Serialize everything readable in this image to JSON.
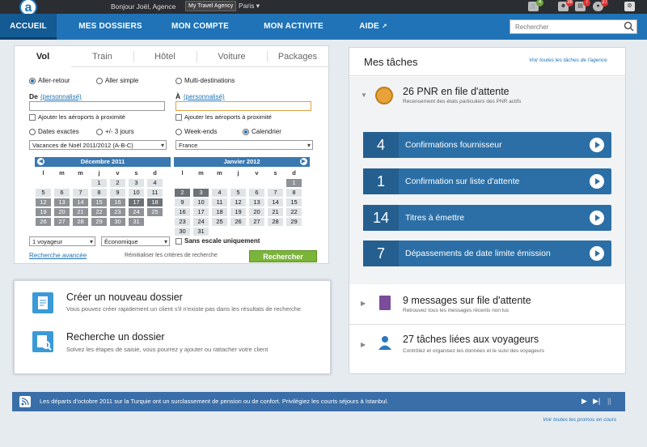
{
  "topbar": {
    "greeting": "Bonjour Joël, Agence",
    "agency": "My Travel Agency",
    "city": "Paris",
    "badges": [
      "4",
      "38",
      "7",
      "27"
    ]
  },
  "nav": {
    "items": [
      "ACCUEIL",
      "MES DOSSIERS",
      "MON COMPTE",
      "MON ACTIVITE",
      "AIDE"
    ],
    "search_placeholder": "Rechercher"
  },
  "booking": {
    "tabs": [
      "Vol",
      "Train",
      "Hôtel",
      "Voiture",
      "Packages"
    ],
    "trip_types": [
      "Aller-retour",
      "Aller simple",
      "Multi-destinations"
    ],
    "from_label": "De",
    "to_label": "À",
    "customize": "(personnalisé)",
    "nearby": "Ajouter les aéroports à proximité",
    "date_modes": [
      "Dates exactes",
      "+/- 3 jours",
      "Week-ends",
      "Calendrier"
    ],
    "period": "Vacances de Noël 2011/2012 (A-B-C)",
    "country": "France",
    "months": [
      {
        "title": "Décembre 2011",
        "weeks": [
          [
            "",
            "",
            "",
            "1",
            "2",
            "3",
            "4"
          ],
          [
            "5",
            "6",
            "7",
            "8",
            "9",
            "10",
            "11"
          ],
          [
            "12",
            "13",
            "14",
            "15",
            "16",
            "17",
            "18"
          ],
          [
            "19",
            "20",
            "21",
            "22",
            "23",
            "24",
            "25"
          ],
          [
            "26",
            "27",
            "28",
            "29",
            "30",
            "31",
            ""
          ]
        ]
      },
      {
        "title": "Janvier 2012",
        "weeks": [
          [
            "",
            "",
            "",
            "",
            "",
            "",
            "1"
          ],
          [
            "2",
            "3",
            "4",
            "5",
            "6",
            "7",
            "8"
          ],
          [
            "9",
            "10",
            "11",
            "12",
            "13",
            "14",
            "15"
          ],
          [
            "16",
            "17",
            "18",
            "19",
            "20",
            "21",
            "22"
          ],
          [
            "23",
            "24",
            "25",
            "26",
            "27",
            "28",
            "29"
          ],
          [
            "30",
            "31",
            "",
            "",
            "",
            "",
            ""
          ]
        ]
      }
    ],
    "weekdays": [
      "l",
      "m",
      "m",
      "j",
      "v",
      "s",
      "d"
    ],
    "travelers": "1 voyageur",
    "cabin": "Économique",
    "nonstop": "Sans escale uniquement",
    "advanced": "Recherche avancée",
    "reset": "Réinitialiser les critères de recherche",
    "search_btn": "Rechercher"
  },
  "dossiers": {
    "create_title": "Créer un nouveau dossier",
    "create_sub": "Vous pouvez créer rapidement un client s'il n'existe pas dans les résultats de recherche",
    "find_title": "Recherche un dossier",
    "find_sub": "Solvez les étapes de saisie, vous pourrez y ajouter ou rattacher votre client"
  },
  "tasks": {
    "title": "Mes tâches",
    "all_link": "Voir toutes les tâches de l'agence",
    "pnr_title": "26 PNR en file d'attente",
    "pnr_sub": "Recensement des états particuliers des PNR actifs",
    "rows": [
      {
        "count": "4",
        "label": "Confirmations fournisseur"
      },
      {
        "count": "1",
        "label": "Confirmation sur liste d'attente"
      },
      {
        "count": "14",
        "label": "Titres à émettre"
      },
      {
        "count": "7",
        "label": "Dépassements de date limite émission"
      }
    ],
    "msg_title": "9 messages sur file d'attente",
    "msg_sub": "Retrouvez tous les messages récents non lus",
    "trav_title": "27 tâches liées aux voyageurs",
    "trav_sub": "Contrôlez et organisez les données et le suivi des voyageurs"
  },
  "ticker": {
    "text": "Les départs d'octobre 2011 sur la Turquie ont un surclassement de pension ou de confort. Privilégiez les courts séjours à Istanbul.",
    "promos_link": "Voir toutes les promos en cours"
  },
  "colors": {
    "brand": "#1f73b6",
    "accent": "#7bb43a",
    "topbar": "#2a2d31"
  }
}
